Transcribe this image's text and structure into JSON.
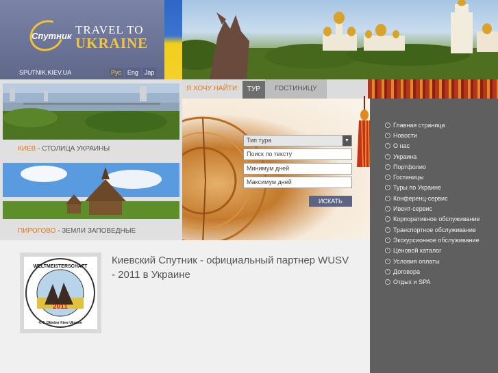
{
  "brand": {
    "logo_text": "Спутник",
    "tagline_line1": "TRAVEL TO",
    "tagline_line2": "UKRAINE",
    "domain": "SPUTNIK.KIEV.UA"
  },
  "languages": [
    {
      "label": "Рус",
      "active": true
    },
    {
      "label": "Eng",
      "active": false
    },
    {
      "label": "Jap",
      "active": false
    }
  ],
  "features": [
    {
      "accent": "Киев",
      "separator": " - ",
      "text": "столица Украины"
    },
    {
      "accent": "Пирогово",
      "separator": " - ",
      "text": "земли заповедные"
    }
  ],
  "search": {
    "label": "Я хочу найти:",
    "tabs": [
      "Тур",
      "Гостиницу"
    ],
    "tour_type": "Тип тура",
    "text_placeholder": "Поиск по тексту",
    "min_days_placeholder": "Минимум дней",
    "max_days_placeholder": "Максимум дней",
    "submit": "Искать"
  },
  "nav": [
    "Главная страница",
    "Новости",
    "О нас",
    "Украина",
    "Портфолио",
    "Гостиницы",
    "Туры по Украине",
    "Конференц-сервис",
    "Ивент-сервис",
    "Корпоративное обслуживание",
    "Транспортное обслуживание",
    "Экскурсионное обслуживание",
    "Ценовой каталог",
    "Условия оплаты",
    "Договора",
    "Отдых и SPA"
  ],
  "news": {
    "title": "Киевский Спутник - официальный партнер WUSV - 2011 в Украине",
    "badge_top": "WELTMEISTERSCHAFT",
    "badge_year": "2011",
    "badge_bottom": "4.-9. Oktober Kiew Ukraine"
  },
  "colors": {
    "accent": "#e0781f",
    "header": "#6a7397",
    "sidebar": "#5f5f5f",
    "button": "#5d6483"
  }
}
